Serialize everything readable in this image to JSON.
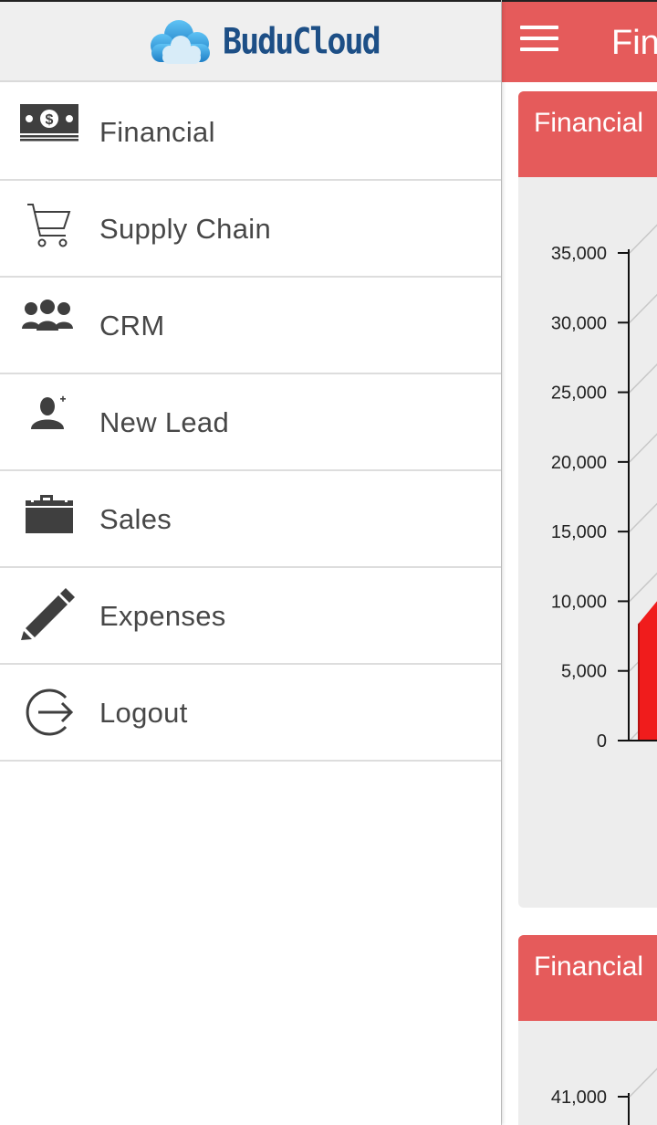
{
  "app": {
    "name": "BuduCloud",
    "page_title": "Fin",
    "brand_colors": {
      "accent": "#e55b5b",
      "brand": "#1d4f86",
      "chart_fill": "#f01c1c"
    }
  },
  "drawer": {
    "items": [
      {
        "label": "Financial",
        "icon": "money-icon"
      },
      {
        "label": "Supply Chain",
        "icon": "shopping-cart-icon"
      },
      {
        "label": "CRM",
        "icon": "users-icon"
      },
      {
        "label": "New Lead",
        "icon": "add-user-icon"
      },
      {
        "label": "Sales",
        "icon": "briefcase-icon"
      },
      {
        "label": "Expenses",
        "icon": "pencil-icon"
      },
      {
        "label": "Logout",
        "icon": "logout-icon"
      }
    ]
  },
  "cards": [
    {
      "title": "Financial"
    },
    {
      "title": "Financial"
    }
  ],
  "chart_data": [
    {
      "type": "area",
      "title": "",
      "yticks": [
        "0",
        "5,000",
        "10,000",
        "15,000",
        "20,000",
        "25,000",
        "30,000",
        "35,000"
      ],
      "ylim": [
        0,
        35000
      ],
      "series": [
        {
          "values": [
            8500,
            10000
          ]
        }
      ]
    },
    {
      "type": "area",
      "title": "",
      "yticks": [
        "41,000"
      ]
    }
  ]
}
